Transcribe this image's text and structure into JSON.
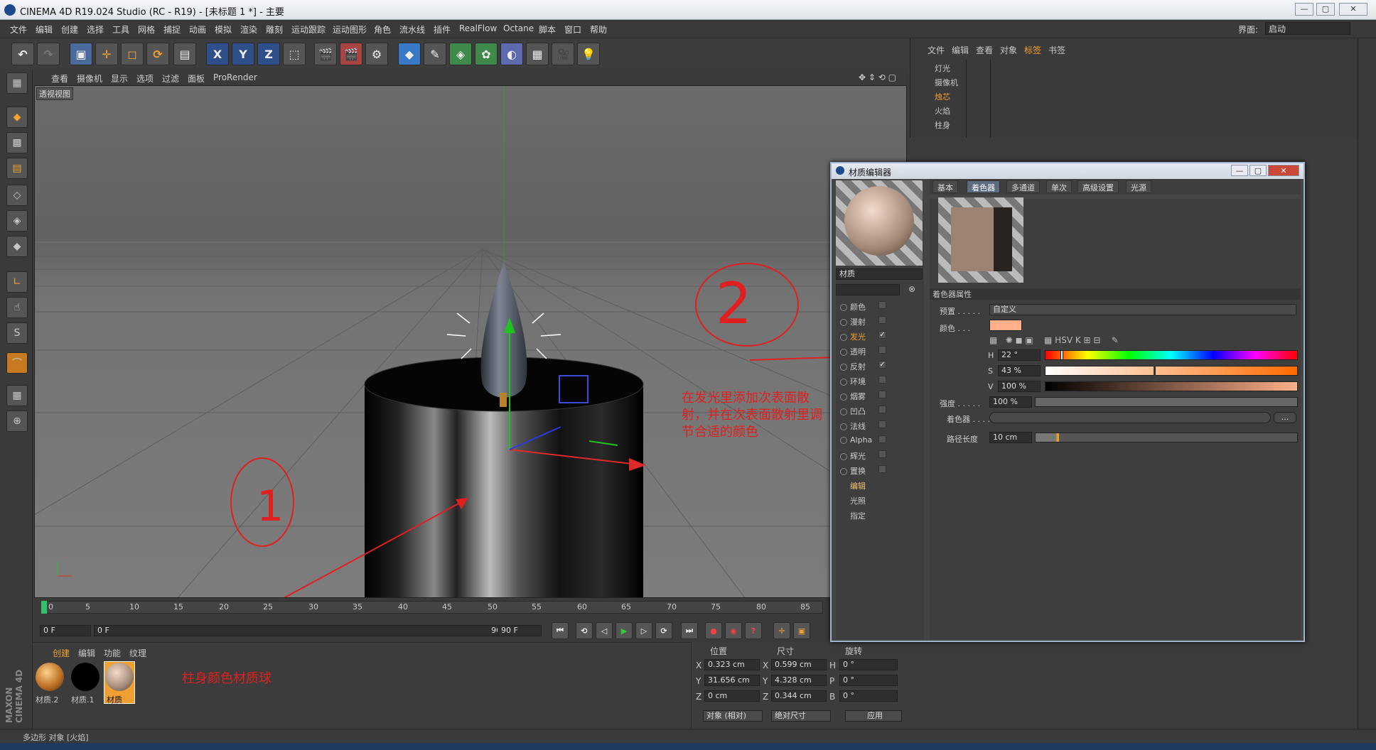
{
  "window": {
    "title": "CINEMA 4D R19.024 Studio (RC - R19) - [未标题 1 *] - 主要",
    "layout_label": "界面:",
    "layout_value": "启动"
  },
  "menu": [
    "文件",
    "编辑",
    "创建",
    "选择",
    "工具",
    "网格",
    "捕捉",
    "动画",
    "模拟",
    "渲染",
    "雕刻",
    "运动跟踪",
    "运动图形",
    "角色",
    "流水线",
    "插件",
    "RealFlow",
    "Octane",
    "脚本",
    "窗口",
    "帮助"
  ],
  "viewport": {
    "menu": [
      "查看",
      "摄像机",
      "显示",
      "选项",
      "过滤",
      "面板",
      "ProRender"
    ],
    "label": "透视视图"
  },
  "timeline": {
    "ticks": [
      "0",
      "5",
      "10",
      "15",
      "20",
      "25",
      "30",
      "35",
      "40",
      "45",
      "50",
      "55",
      "60",
      "65",
      "70",
      "75",
      "80",
      "85"
    ],
    "start": "0 F",
    "current": "0 F",
    "end_field": "90 F",
    "end": "90 F"
  },
  "materials": {
    "tabs": [
      "创建",
      "编辑",
      "功能",
      "纹理"
    ],
    "items": [
      "材质.2",
      "材质.1",
      "材质"
    ]
  },
  "coords": {
    "headers": [
      "位置",
      "尺寸",
      "旋转"
    ],
    "rows": [
      {
        "axis": "X",
        "pos": "0.323 cm",
        "saxis": "X",
        "size": "0.599 cm",
        "raxis": "H",
        "rot": "0 °"
      },
      {
        "axis": "Y",
        "pos": "31.656 cm",
        "saxis": "Y",
        "size": "4.328 cm",
        "raxis": "P",
        "rot": "0 °"
      },
      {
        "axis": "Z",
        "pos": "0 cm",
        "saxis": "Z",
        "size": "0.344 cm",
        "raxis": "B",
        "rot": "0 °"
      }
    ],
    "mode": "对象 (相对)",
    "size_mode": "绝对尺寸",
    "apply": "应用"
  },
  "object_manager": {
    "menu": [
      "文件",
      "编辑",
      "查看",
      "对象",
      "标签",
      "书签"
    ],
    "objects": [
      "灯光",
      "摄像机",
      "烛芯",
      "火焰",
      "柱身"
    ]
  },
  "status": "多边形 对象 [火焰]",
  "material_editor": {
    "title": "材质编辑器",
    "name_label": "材质",
    "tabs": [
      "基本",
      "着色器",
      "多通道",
      "单次",
      "高级设置",
      "光源"
    ],
    "active_tab": "着色器",
    "channels": [
      {
        "label": "颜色",
        "checked": ""
      },
      {
        "label": "漫射",
        "checked": ""
      },
      {
        "label": "发光",
        "checked": "✓"
      },
      {
        "label": "透明",
        "checked": ""
      },
      {
        "label": "反射",
        "checked": "✓"
      },
      {
        "label": "环境",
        "checked": ""
      },
      {
        "label": "烟雾",
        "checked": ""
      },
      {
        "label": "凹凸",
        "checked": ""
      },
      {
        "label": "法线",
        "checked": ""
      },
      {
        "label": "Alpha",
        "checked": ""
      },
      {
        "label": "辉光",
        "checked": ""
      },
      {
        "label": "置换",
        "checked": ""
      }
    ],
    "extra": [
      "编辑",
      "光照",
      "指定"
    ],
    "section": "着色器属性",
    "preset_label": "预置 . . . . .",
    "preset_value": "自定义",
    "color_label": "颜色 . . .",
    "swatch": "#ffb08a",
    "h_label": "H",
    "h_value": "22 °",
    "h_frac": 0.06,
    "s_label": "S",
    "s_value": "43 %",
    "s_frac": 0.43,
    "v_label": "V",
    "v_value": "100 %",
    "strength_label": "强度 . . . . .",
    "strength_value": "100 %",
    "shader_label": "着色器 . . . .",
    "shader_btn": "...",
    "path_label": "路径长度",
    "path_value": "10 cm"
  },
  "annotations": {
    "one": "1",
    "two": "2",
    "note": "在发光里添加次表面散射，并在次表面散射里调节合适的颜色",
    "material_note": "柱身颜色材质球"
  },
  "colors": {
    "accent": "#f0a030",
    "annotation": "#e02020",
    "active_tab": "#5c6b7e"
  }
}
